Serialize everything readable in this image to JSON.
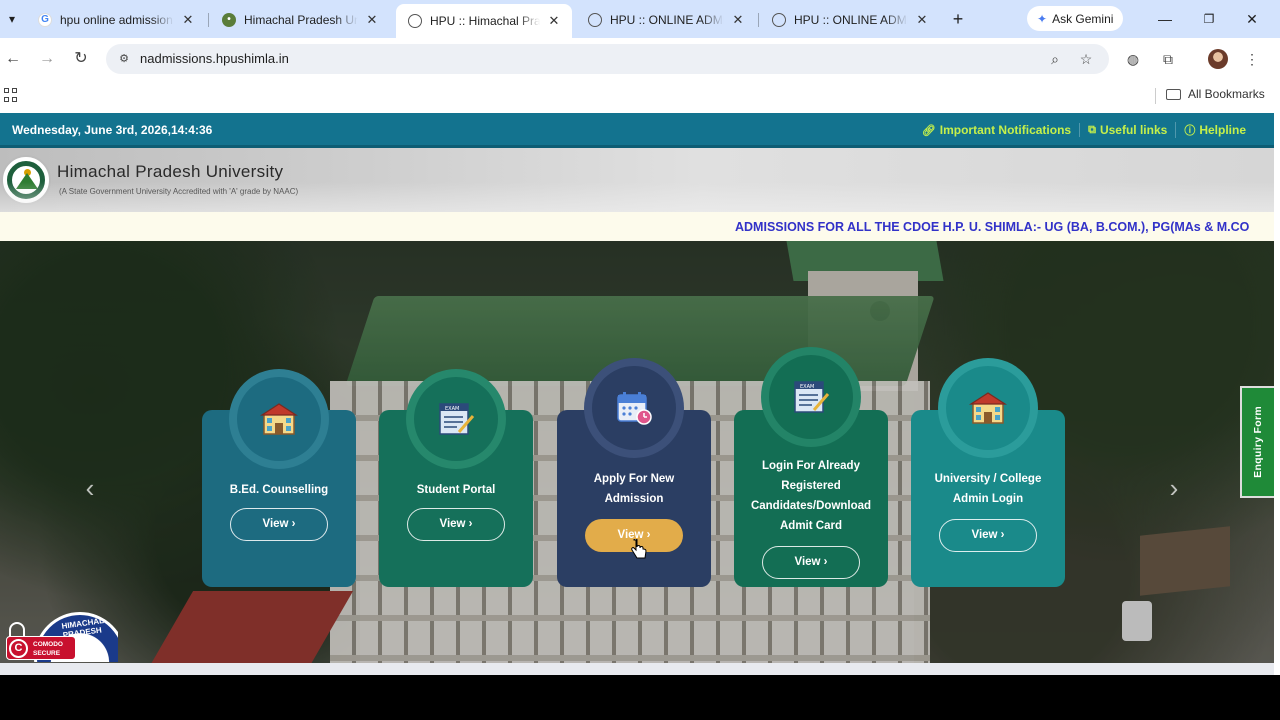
{
  "browser": {
    "tabs": [
      {
        "title": "hpu online admission -",
        "favicon": "google-icon"
      },
      {
        "title": "Himachal Pradesh Univ",
        "favicon": "hpu-logo-icon"
      },
      {
        "title": "HPU :: Himachal Prades",
        "favicon": "globe-icon",
        "active": true
      },
      {
        "title": "HPU :: ONLINE ADMISS",
        "favicon": "globe-icon"
      },
      {
        "title": "HPU :: ONLINE ADMISS",
        "favicon": "globe-icon"
      }
    ],
    "gemini_label": "Ask Gemini",
    "url": "nadmissions.hpushimla.in",
    "bookmarks_label": "All Bookmarks"
  },
  "topbar": {
    "date": "Wednesday, June 3rd, 2026,14:4:36",
    "links": [
      {
        "label": "Important Notifications",
        "icon": "link-icon"
      },
      {
        "label": "Useful links",
        "icon": "external-link-icon"
      },
      {
        "label": "Helpline",
        "icon": "info-icon"
      }
    ],
    "link_color": "#c6f04a",
    "bg_color": "#13738f"
  },
  "header": {
    "title": "Himachal Pradesh University",
    "subtitle": "(A State Government University Accredited with 'A' grade by NAAC)"
  },
  "ticker": {
    "text": "ADMISSIONS FOR ALL THE CDOE H.P. U. SHIMLA:- UG (BA, B.COM.), PG(MAs & M.CO"
  },
  "cards": [
    {
      "label": "B.Ed. Counselling",
      "button": "View ›",
      "icon": "building-icon",
      "color": "#1d6b80"
    },
    {
      "label": "Student Portal",
      "button": "View ›",
      "icon": "exam-icon",
      "color": "#15705a"
    },
    {
      "label": "Apply For New Admission",
      "button": "View ›",
      "icon": "calendar-icon",
      "color": "#2b3e63"
    },
    {
      "label": "Login For Already Registered Candidates/Download Admit Card",
      "button": "View ›",
      "icon": "exam-icon",
      "color": "#136e54"
    },
    {
      "label": "University / College Admin Login",
      "button": "View ›",
      "icon": "building-icon",
      "color": "#1a8a8a"
    }
  ],
  "enquiry_label": "Enquiry Form",
  "seal": {
    "arc_text": "HIMACHAL PRADESH",
    "badge_line1": "COMODO",
    "badge_line2": "SECURE"
  },
  "arrows": {
    "prev": "‹",
    "next": "›"
  }
}
